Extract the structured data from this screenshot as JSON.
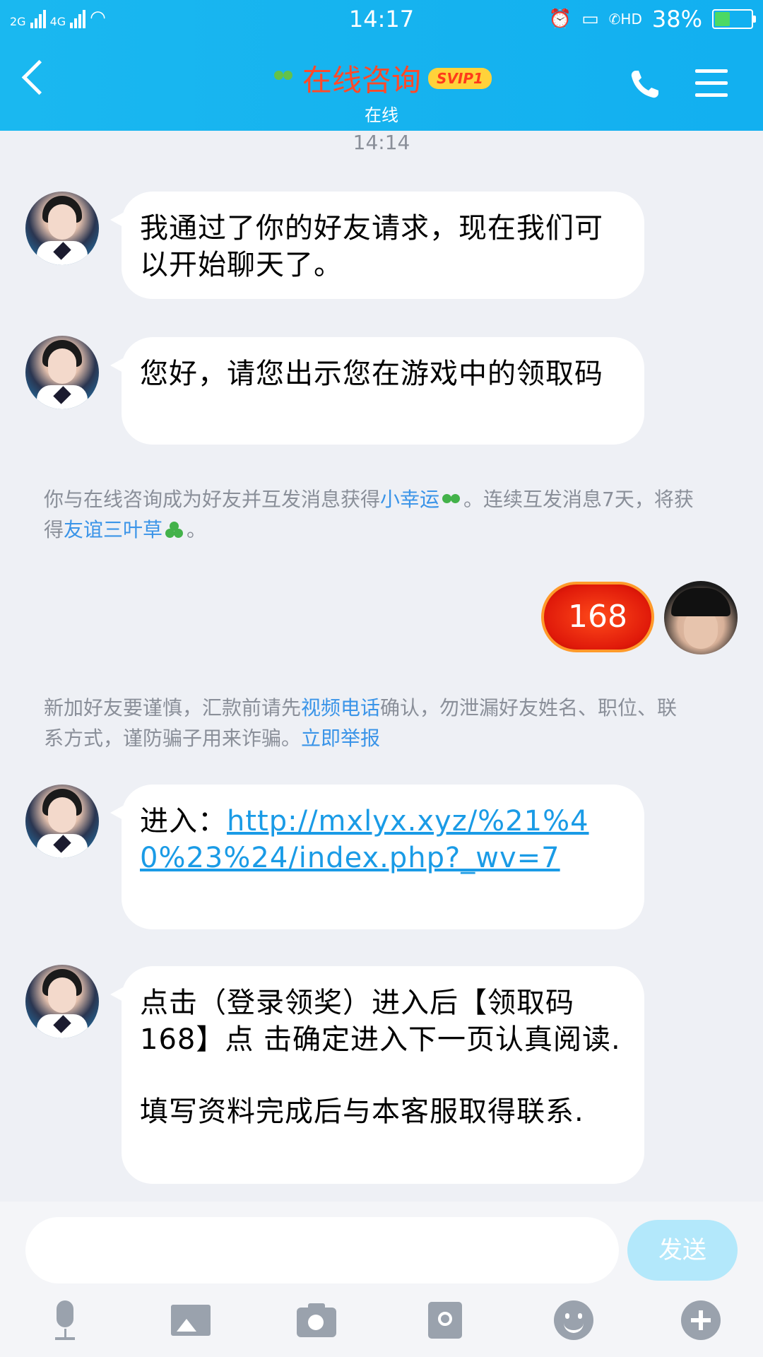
{
  "status": {
    "network_1": "2G",
    "network_2": "4G",
    "time": "14:17",
    "hd": "HD",
    "battery": "38%"
  },
  "header": {
    "title": "在线咨询",
    "badge": "SVIP1",
    "subtitle": "在线"
  },
  "chat": {
    "timestamp": "14:14",
    "messages": [
      {
        "text": "我通过了你的好友请求，现在我们可以开始聊天了。"
      },
      {
        "text": "您好，请您出示您在游戏中的领取码"
      },
      {
        "prefix": "进入：",
        "link": "http://mxlyx.xyz/%21%40%23%24/index.php?_wv=7"
      },
      {
        "line1": "点击（登录领奖）进入后【领取码168】点 击确定进入下一页认真阅读.",
        "line2": "填写资料完成后与本客服取得联系."
      }
    ],
    "system1": {
      "p1": "你与在线咨询成为好友并互发消息获得",
      "link1": "小幸运",
      "p2": "。连续互发消息7天，将获得",
      "link2": "友谊三叶草",
      "p3": "。"
    },
    "redpacket_value": "168",
    "system2": {
      "p1": "新加好友要谨慎，汇款前请先",
      "link1": "视频电话",
      "p2": "确认，勿泄漏好友姓名、职位、联系方式，谨防骗子用来诈骗。",
      "link2": "立即举报"
    }
  },
  "input": {
    "send_label": "发送",
    "placeholder": ""
  }
}
